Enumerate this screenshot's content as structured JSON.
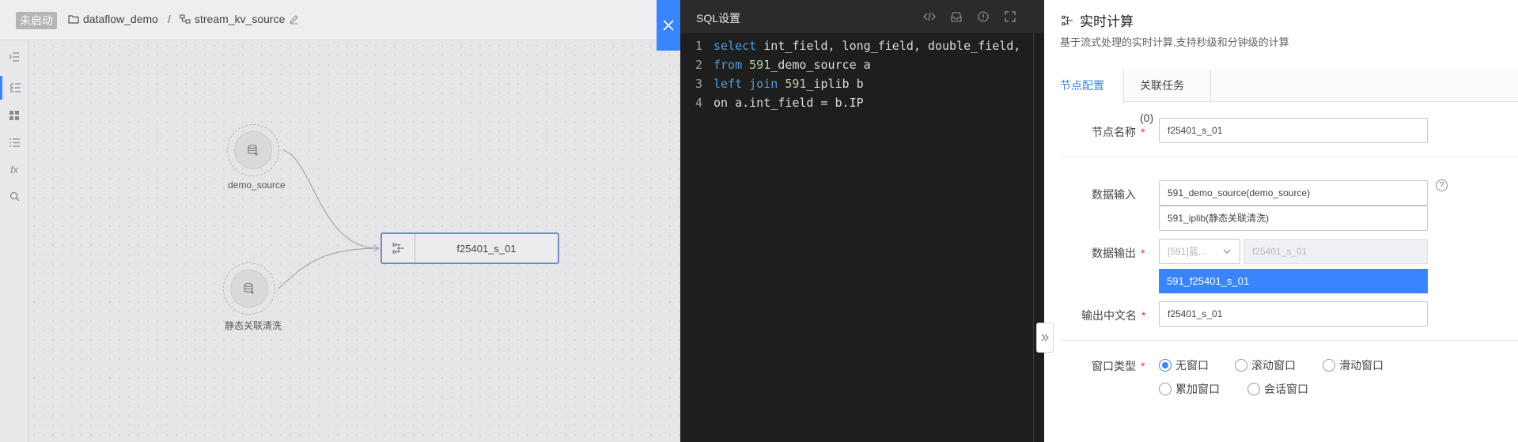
{
  "topbar": {
    "status": "未启动",
    "project": "dataflow_demo",
    "separator": "/",
    "flow": "stream_kv_source"
  },
  "rail": {
    "icons": [
      "list-indent-icon",
      "tree-list-icon",
      "grid-apps-icon",
      "bullet-list-icon",
      "function-icon",
      "search-icon"
    ],
    "fx_label": "fx"
  },
  "canvas": {
    "nodes": [
      {
        "label": "demo_source"
      },
      {
        "label": "静态关联清洗"
      }
    ],
    "calc_node": {
      "label": "f25401_s_01"
    }
  },
  "sql": {
    "title": "SQL设置",
    "tools": [
      "code-icon",
      "inbox-icon",
      "info-icon",
      "fullscreen-icon"
    ],
    "lines": [
      {
        "no": "1",
        "text": "select int_field, long_field, double_field,"
      },
      {
        "no": "2",
        "text": "from 591_demo_source a"
      },
      {
        "no": "3",
        "text": "left join 591_iplib b"
      },
      {
        "no": "4",
        "text": "on a.int_field = b.IP"
      }
    ]
  },
  "config": {
    "title": "实时计算",
    "subtitle": "基于流式处理的实时计算,支持秒级和分钟级的计算",
    "tabs": [
      "节点配置",
      "关联任务(0)"
    ],
    "node_name_label": "节点名称",
    "node_name_value": "f25401_s_01",
    "input_label": "数据输入",
    "inputs": [
      "591_demo_source(demo_source)",
      "591_iplib(静态关联清洗)"
    ],
    "help": "?",
    "output_label": "数据输出",
    "output_prefix": "[591]蓝...",
    "output_name": "f25401_s_01",
    "output_dropdown_item": "591_f25401_s_01",
    "cn_name_label": "输出中文名",
    "cn_name_value": "f25401_s_01",
    "window_label": "窗口类型",
    "window_options": [
      "无窗口",
      "滚动窗口",
      "滑动窗口",
      "累加窗口",
      "会话窗口"
    ],
    "window_selected": "无窗口",
    "required_mark": "*"
  },
  "colors": {
    "accent": "#3a84ff",
    "required": "#ea3636",
    "editor_bg": "#1e1e1e",
    "keyword": "#569cd6",
    "number": "#b5cea8"
  }
}
